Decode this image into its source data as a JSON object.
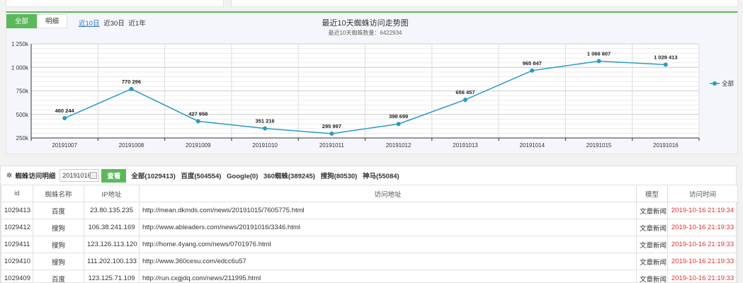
{
  "filters": {
    "tabs": [
      {
        "label": "全部",
        "active": true
      },
      {
        "label": "明细",
        "active": false
      }
    ],
    "ranges": [
      {
        "label": "近10日",
        "selected": true
      },
      {
        "label": "近30日",
        "selected": false
      },
      {
        "label": "近1年",
        "selected": false
      }
    ]
  },
  "chart_data": {
    "type": "line",
    "title": "最近10天蜘蛛访问走势图",
    "subtitle": "最近10天蜘蛛数量：6422934",
    "categories": [
      "20191007",
      "20191008",
      "20191009",
      "20191010",
      "20191011",
      "20191012",
      "20191013",
      "20191014",
      "20191015",
      "20191016"
    ],
    "series": [
      {
        "name": "全部",
        "values": [
          460244,
          770296,
          427958,
          351216,
          295997,
          398699,
          656457,
          965847,
          1066807,
          1029413
        ],
        "labels": [
          "460 244",
          "770 296",
          "427 958",
          "351 216",
          "295 997",
          "398 699",
          "656 457",
          "965 847",
          "1 066 807",
          "1 029 413"
        ],
        "color": "#2a9ac4"
      }
    ],
    "yticks": [
      250000,
      500000,
      750000,
      1000000,
      1250000
    ],
    "ytick_labels": [
      "250k",
      "500k",
      "750k",
      "1 000k",
      "1 250k"
    ],
    "ylim": [
      250000,
      1250000
    ],
    "grid": true,
    "legend": "right"
  },
  "detail": {
    "heading": "蜘蛛访问明细",
    "date_value": "20191016",
    "view_label": "查看",
    "stats": [
      "全部(1029413)",
      "百度(504554)",
      "Google(0)",
      "360蜘蛛(389245)",
      "搜狗(80530)",
      "神马(55084)"
    ],
    "columns": [
      "id",
      "蜘蛛名称",
      "IP地址",
      "访问地址",
      "模型",
      "访问时间"
    ],
    "rows": [
      [
        "1029413",
        "百度",
        "23.80.135.235",
        "http://mean.dkmds.com/news/20191015/7605775.html",
        "文章新闻",
        "2019-10-16 21:19:34"
      ],
      [
        "1029412",
        "搜狗",
        "106.38.241.169",
        "http://www.ableaders.com/news/20191016/3346.html",
        "文章新闻",
        "2019-10-16 21:19:33"
      ],
      [
        "1029411",
        "搜狗",
        "123.126.113.120",
        "http://home.4yang.com/news/0701976.html",
        "文章新闻",
        "2019-10-16 21:19:33"
      ],
      [
        "1029410",
        "搜狗",
        "111.202.100.133",
        "http://www.360cesu.com/edcc6u57",
        "文章新闻",
        "2019-10-16 21:19:33"
      ],
      [
        "1029409",
        "百度",
        "123.125.71.109",
        "http://run.cxgjdq.com/news/211995.html",
        "文章新闻",
        "2019-10-16 21:19:33"
      ]
    ]
  }
}
